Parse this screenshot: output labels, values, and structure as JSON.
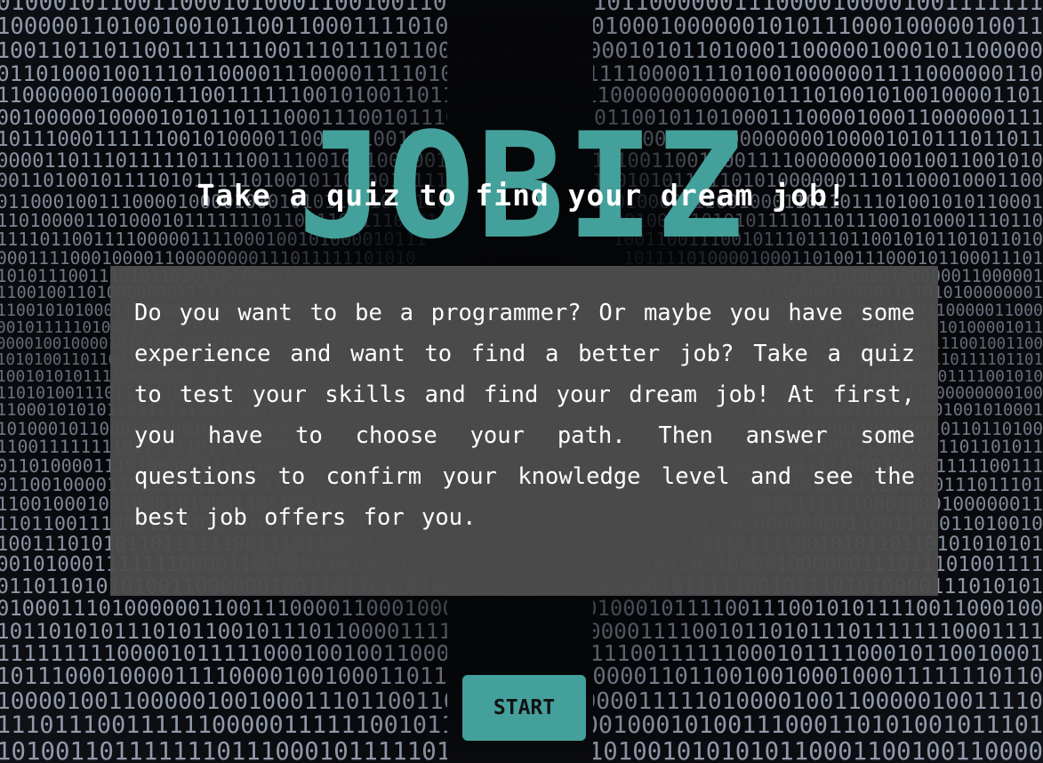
{
  "app": {
    "title": "JOBIZ",
    "subtitle": "Take a quiz to find your dream job!"
  },
  "intro": {
    "text": "Do you want to be a programmer? Or maybe you have some experience and want to find a better job? Take a quiz to test your skills and find your dream job! At first, you have to choose your path. Then answer some questions to confirm your knowledge level and see the best job offers for you."
  },
  "actions": {
    "start_label": "START"
  },
  "colors": {
    "accent": "#44a09a",
    "panel": "#4d4d4d",
    "text": "#ffffff",
    "background": "#06070a"
  },
  "background_image": "binary-code-tunnel"
}
